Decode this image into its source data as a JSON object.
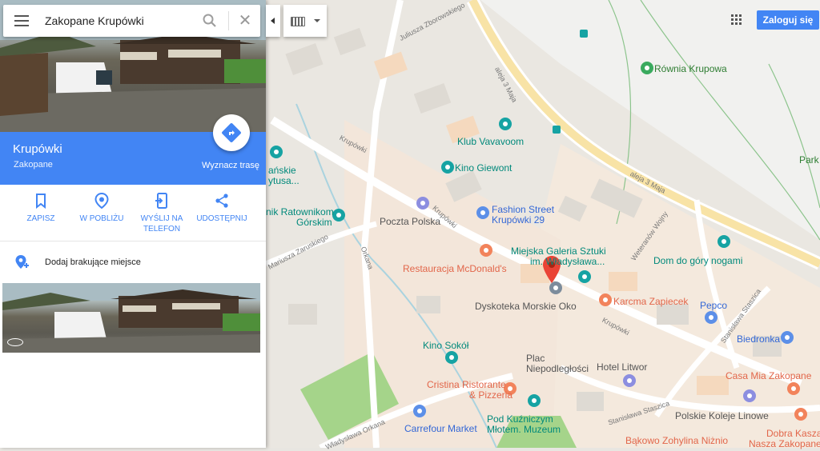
{
  "search": {
    "value": "Zakopane Krupówki"
  },
  "place": {
    "name": "Krupówki",
    "subtitle": "Zakopane",
    "route_label": "Wyznacz trasę"
  },
  "actions": [
    {
      "label": "ZAPISZ"
    },
    {
      "label": "W POBLIŻU"
    },
    {
      "label": "WYŚLIJ NA TELEFON"
    },
    {
      "label": "UDOSTĘPNIJ"
    }
  ],
  "add_missing": "Dodaj brakujące miejsce",
  "header": {
    "sign_in": "Zaloguj się"
  },
  "colors": {
    "accent": "#4285f4",
    "red_pin": "#ea4335",
    "park_green": "#a5d48a",
    "teal_poi": "#00a0a0",
    "orange_poi": "#f2835b"
  },
  "map_labels": {
    "rownia": "Równia Krupowa",
    "park": "Park",
    "klub": "Klub Vavavoom",
    "kino_giewont": "Kino Giewont",
    "fashion1": "Fashion Street",
    "fashion2": "Krupówki 29",
    "poczta": "Poczta Polska",
    "galeria1": "Miejska Galeria Sztuki",
    "galeria2": "im. Władysława...",
    "mcdonalds": "Restauracja McDonald's",
    "dyskoteka": "Dyskoteka Morskie Oko",
    "dom_gory": "Dom do góry nogami",
    "karcma": "Karcma Zapiecek",
    "pepco": "Pepco",
    "biedronka": "Biedronka",
    "kino_sokol": "Kino Sokół",
    "plac1": "Plac",
    "plac2": "Niepodległości",
    "hotel": "Hotel Litwor",
    "casa": "Casa Mia Zakopane",
    "cristina1": "Cristina Ristorante",
    "cristina2": "& Pizzeria",
    "pkl": "Polskie Koleje Linowe",
    "dobra1": "Dobra Kasza",
    "dobra2": "Nasza Zakopane",
    "pod1": "Pod Kuźniczym",
    "pod2": "Młotem. Muzeum",
    "carrefour": "Carrefour Market",
    "bakowo": "Bąkowo Zohylina Niżnio",
    "ratownikom1": "nik Ratownikom",
    "ratownikom2": "Górskim",
    "tanskie1": "ańskie",
    "tanskie2": "ytusa...",
    "s_zborowskiego": "Juliusza Zborowskiego",
    "s_3maja1": "aleja 3 Maja",
    "s_3maja2": "aleja 3 Maja",
    "s_krupowki1": "Krupówki",
    "s_krupowki2": "Krupówki",
    "s_krupowki3": "Krupówki",
    "s_zaruskiego": "Mariusza Zaruskiego",
    "s_orkana1": "Orkana",
    "s_orkana2": "Władysława Orkana",
    "s_wojny": "Weteranów Wojny",
    "s_staszica1": "Stanisława Staszica",
    "s_staszica2": "Stanisława Staszica"
  }
}
